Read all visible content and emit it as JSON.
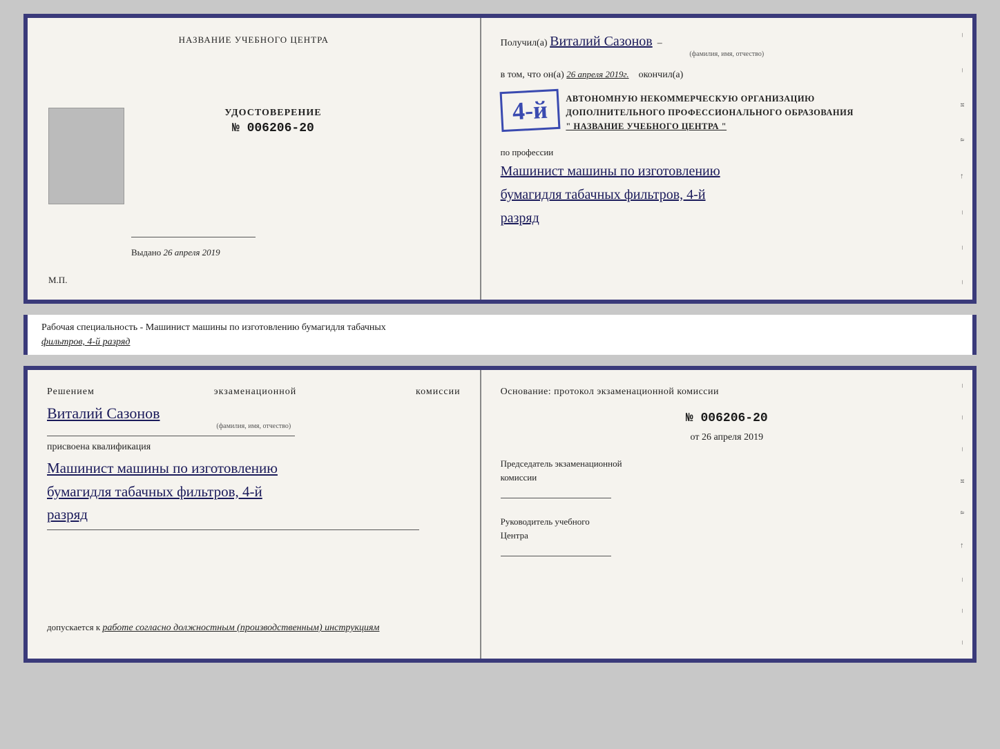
{
  "top_doc": {
    "left": {
      "training_center_label": "НАЗВАНИЕ УЧЕБНОГО ЦЕНТРА",
      "udostoverenie_title": "УДОСТОВЕРЕНИЕ",
      "udostoverenie_number": "№ 006206-20",
      "vydano_label": "Выдано",
      "vydano_date": "26 апреля 2019",
      "mp_label": "М.П."
    },
    "right": {
      "poluchil_prefix": "Получил(а)",
      "recipient_name": "Виталий Сазонов",
      "fio_hint": "(фамилия, имя, отчество)",
      "dash": "–",
      "vtom_text": "в том, что он(а)",
      "date_inline": "26 апреля 2019г.",
      "okonchil": "окончил(а)",
      "stamp_number": "4-й",
      "stamp_line1": "АВТОНОМНУЮ НЕКОММЕРЧЕСКУЮ ОРГАНИЗАЦИЮ",
      "stamp_line2": "ДОПОЛНИТЕЛЬНОГО ПРОФЕССИОНАЛЬНОГО ОБРАЗОВАНИЯ",
      "stamp_line3": "\" НАЗВАНИЕ УЧЕБНОГО ЦЕНТРА \"",
      "po_professii": "по профессии",
      "prof_line1": "Машинист машины по изготовлению",
      "prof_line2": "бумагидля табачных фильтров, 4-й",
      "prof_line3": "разряд"
    }
  },
  "separator": {
    "text_prefix": "Рабочая специальность - Машинист машины по изготовлению бумагидля табачных",
    "text_underline": "фильтров, 4-й разряд"
  },
  "bottom_doc": {
    "left": {
      "resheniem_title": "Решением  экзаменационной  комиссии",
      "person_name": "Виталий Сазонов",
      "fio_hint": "(фамилия, имя, отчество)",
      "prisvoena_text": "присвоена квалификация",
      "kvalif_line1": "Машинист машины по изготовлению",
      "kvalif_line2": "бумагидля табачных фильтров, 4-й",
      "kvalif_line3": "разряд",
      "dopuskaetsya_prefix": "допускается к",
      "dopuskaetsya_italic": "работе согласно должностным (производственным) инструкциям"
    },
    "right": {
      "osnovanie_title": "Основание: протокол экзаменационной  комиссии",
      "proto_number": "№  006206-20",
      "ot_label": "от",
      "ot_date": "26 апреля 2019",
      "predsedatel_line1": "Председатель экзаменационной",
      "predsedatel_line2": "комиссии",
      "rukovoditel_line1": "Руководитель учебного",
      "rukovoditel_line2": "Центра"
    }
  },
  "side_decor": {
    "items": [
      "–",
      "и",
      "а",
      "←",
      "–",
      "–",
      "–",
      "–"
    ]
  }
}
